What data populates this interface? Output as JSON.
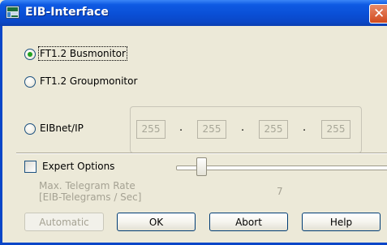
{
  "window": {
    "title": "EIB-Interface",
    "close_glyph": "✕"
  },
  "connection": {
    "options": [
      {
        "label": "FT1.2 Busmonitor",
        "selected": true
      },
      {
        "label": "FT1.2 Groupmonitor",
        "selected": false
      },
      {
        "label": "EIBnet/IP",
        "selected": false
      }
    ],
    "ip_octets": [
      "255",
      "255",
      "255",
      "255"
    ],
    "ip_separator": "."
  },
  "expert": {
    "checkbox_label": "Expert Options",
    "checked": false,
    "rate_label_line1": "Max. Telegram Rate",
    "rate_label_line2": "[EIB-Telegrams / Sec]",
    "rate_value": "7"
  },
  "buttons": {
    "automatic": "Automatic",
    "ok": "OK",
    "abort": "Abort",
    "help": "Help"
  },
  "colors": {
    "titlebar": "#0a4fd6",
    "dialog_bg": "#ece9d8",
    "radio_dot": "#21a121",
    "close_button": "#d24a1c"
  }
}
